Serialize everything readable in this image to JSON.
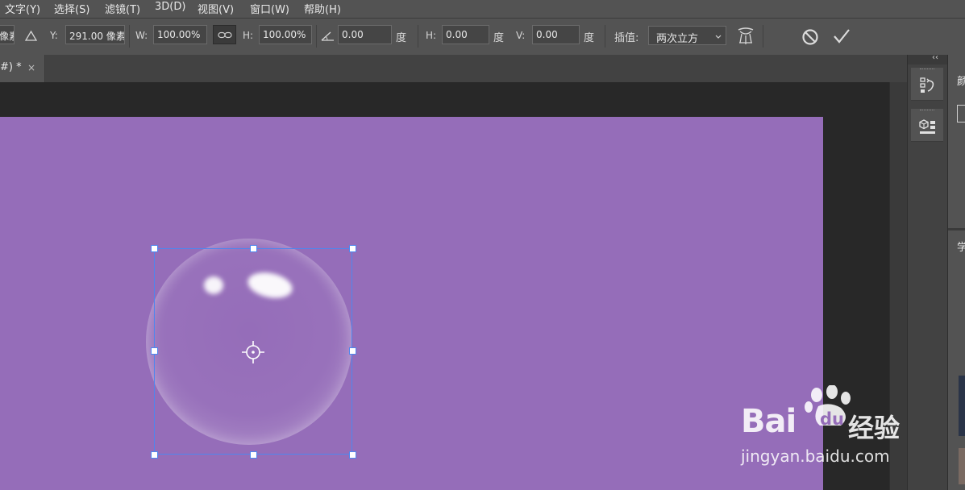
{
  "menu": [
    "文字(Y)",
    "选择(S)",
    "滤镜(T)",
    "3D(D)",
    "视图(V)",
    "窗口(W)",
    "帮助(H)"
  ],
  "options": {
    "x_value_fragment": "像素",
    "y_label": "Y:",
    "y_value": "291.00 像素",
    "w_label": "W:",
    "w_value": "100.00%",
    "h_label": "H:",
    "h_value": "100.00%",
    "angle_value": "0.00",
    "angle_unit": "度",
    "skew_h_label": "H:",
    "skew_h_value": "0.00",
    "skew_h_unit": "度",
    "skew_v_label": "V:",
    "skew_v_value": "0.00",
    "skew_v_unit": "度",
    "interp_label": "插值:",
    "interp_value": "两次立方"
  },
  "document_tab": {
    "title": "#) *",
    "close": "×"
  },
  "right_panels": {
    "tab_1_char": "颜",
    "tab_2_char": "学"
  },
  "icons": [
    "warp-triangle-icon",
    "link-icon",
    "angle-icon",
    "chevron-down-icon",
    "warp-mode-icon",
    "cancel-icon",
    "commit-check-icon",
    "history-panel-icon",
    "3d-panel-icon",
    "reference-point-icon"
  ],
  "colors": {
    "canvas": "#956db9",
    "selection": "#4f86ee",
    "chrome": "#535353"
  },
  "watermark": {
    "brand_latin": "Bai",
    "brand_du": "du",
    "brand_cn": "经验",
    "url": "jingyan.baidu.com"
  }
}
